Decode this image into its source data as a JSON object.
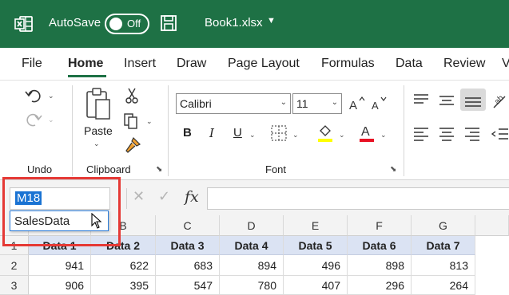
{
  "titlebar": {
    "app_icon": "excel-logo-icon",
    "autosave_label": "AutoSave",
    "toggle_state": "Off",
    "save_icon": "save-icon",
    "filename": "Book1.xlsx",
    "accent": "#1e7145"
  },
  "tabs": [
    {
      "label": "File"
    },
    {
      "label": "Home"
    },
    {
      "label": "Insert"
    },
    {
      "label": "Draw"
    },
    {
      "label": "Page Layout"
    },
    {
      "label": "Formulas"
    },
    {
      "label": "Data"
    },
    {
      "label": "Review"
    },
    {
      "label": "V"
    }
  ],
  "active_tab": "Home",
  "ribbon": {
    "undo_group": "Undo",
    "clipboard": {
      "label": "Clipboard",
      "paste_label": "Paste"
    },
    "font": {
      "label": "Font",
      "font_name": "Calibri",
      "font_size": "11",
      "bold": "B",
      "italic": "I",
      "underline": "U",
      "font_color": "A",
      "highlight_color": "#ffff00",
      "font_color_hex": "#e81123"
    }
  },
  "formula_bar": {
    "name_box": "M18",
    "fx_label": "fx",
    "formula": ""
  },
  "name_dropdown": {
    "items": [
      "SalesData"
    ]
  },
  "sheet": {
    "columns": [
      "B",
      "C",
      "D",
      "E",
      "F",
      "G"
    ],
    "rows": [
      {
        "num": "1",
        "cells": [
          "Data 1",
          "Data 2",
          "Data 3",
          "Data 4",
          "Data 5",
          "Data 6",
          "Data 7"
        ]
      },
      {
        "num": "2",
        "cells": [
          "941",
          "622",
          "683",
          "894",
          "496",
          "898",
          "813"
        ]
      },
      {
        "num": "3",
        "cells": [
          "906",
          "395",
          "547",
          "780",
          "407",
          "296",
          "264"
        ]
      }
    ]
  }
}
